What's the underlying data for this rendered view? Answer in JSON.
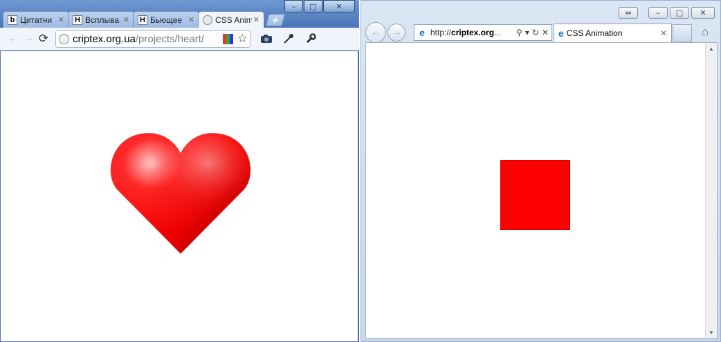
{
  "chrome": {
    "tabs": [
      {
        "label": "Цитатни",
        "favicon": "b"
      },
      {
        "label": "Всплыва",
        "favicon": "H"
      },
      {
        "label": "Бьющее",
        "favicon": "H"
      },
      {
        "label": "CSS Anim",
        "favicon": "globe-icon",
        "active": true
      }
    ],
    "new_tab": "+",
    "window_controls": {
      "minimize": "–",
      "maximize": "□",
      "close": "✕"
    },
    "address": {
      "host": "criptex.org.ua",
      "path": "/projects/heart/"
    },
    "page": {
      "graphic": "heart",
      "color": "#ff0000"
    }
  },
  "ie": {
    "window_controls": {
      "restore": "⇔",
      "minimize": "–",
      "maximize": "□",
      "close": "✕"
    },
    "address": {
      "prefix": "http://",
      "host": "criptex.org",
      "suffix": "..."
    },
    "tab": {
      "label": "CSS Animation"
    },
    "page": {
      "graphic": "square",
      "color": "#ff0000"
    }
  }
}
